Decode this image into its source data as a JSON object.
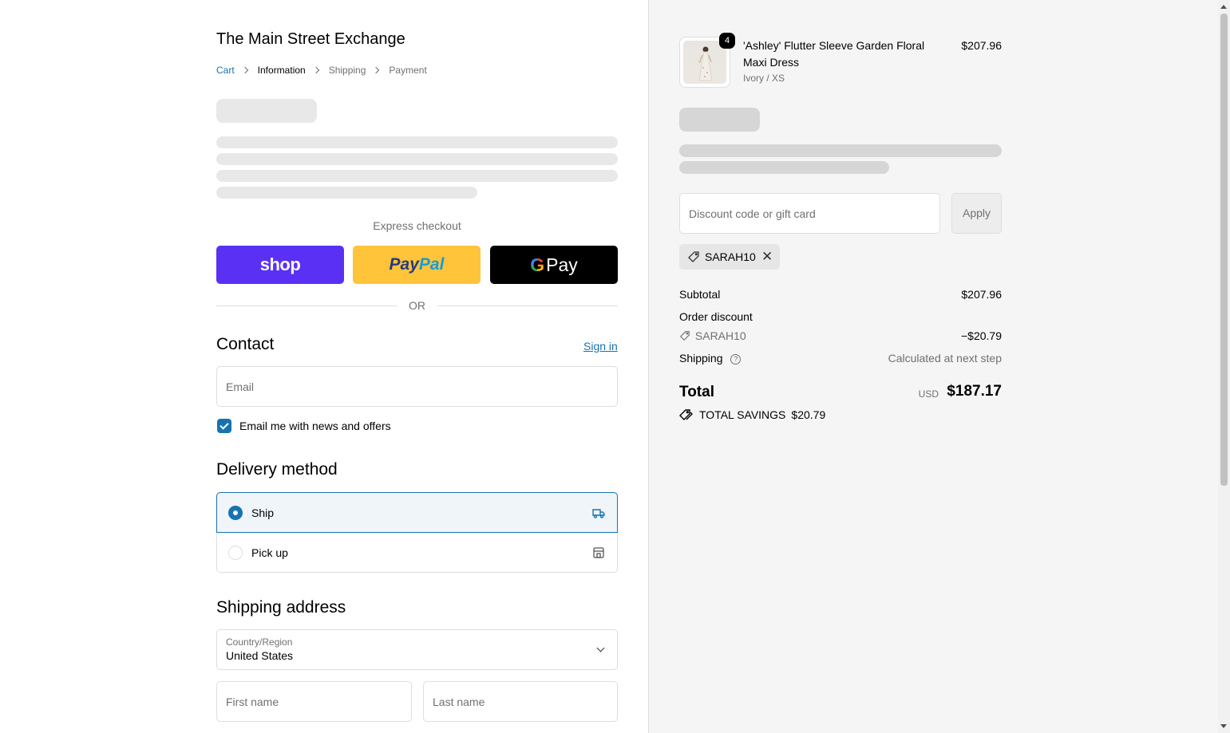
{
  "store": {
    "title": "The Main Street Exchange"
  },
  "breadcrumb": [
    "Cart",
    "Information",
    "Shipping",
    "Payment"
  ],
  "express": {
    "label": "Express checkout",
    "shop_label": "shop",
    "paypal_part1": "Pay",
    "paypal_part2": "Pal",
    "gpay_g": "G",
    "gpay_label": "Pay",
    "or_label": "OR"
  },
  "contact": {
    "heading": "Contact",
    "signin_label": "Sign in",
    "email_placeholder": "Email",
    "newsletter_label": "Email me with news and offers",
    "newsletter_checked": true
  },
  "delivery": {
    "heading": "Delivery method",
    "options": [
      {
        "label": "Ship",
        "selected": true,
        "icon": "truck-icon"
      },
      {
        "label": "Pick up",
        "selected": false,
        "icon": "store-icon"
      }
    ]
  },
  "shipping": {
    "heading": "Shipping address",
    "country_label": "Country/Region",
    "country_value": "United States",
    "first_name_placeholder": "First name",
    "last_name_placeholder": "Last name"
  },
  "order": {
    "item": {
      "quantity": "4",
      "name": "'Ashley' Flutter Sleeve Garden Floral Maxi Dress",
      "variant": "Ivory / XS",
      "price": "$207.96"
    },
    "discount_placeholder": "Discount code or gift card",
    "apply_label": "Apply",
    "applied_code": "SARAH10",
    "subtotal_label": "Subtotal",
    "subtotal_value": "$207.96",
    "order_discount_label": "Order discount",
    "discount_code": "SARAH10",
    "discount_value": "−$20.79",
    "shipping_label": "Shipping",
    "shipping_value": "Calculated at next step",
    "total_label": "Total",
    "total_currency": "USD",
    "total_value": "$187.17",
    "savings_label": "TOTAL SAVINGS",
    "savings_value": "$20.79"
  },
  "colors": {
    "accent": "#1773b0",
    "shop_pay": "#5a31f4",
    "paypal": "#ffc439",
    "gpay": "#000000",
    "summary_bg": "#f5f5f5"
  }
}
